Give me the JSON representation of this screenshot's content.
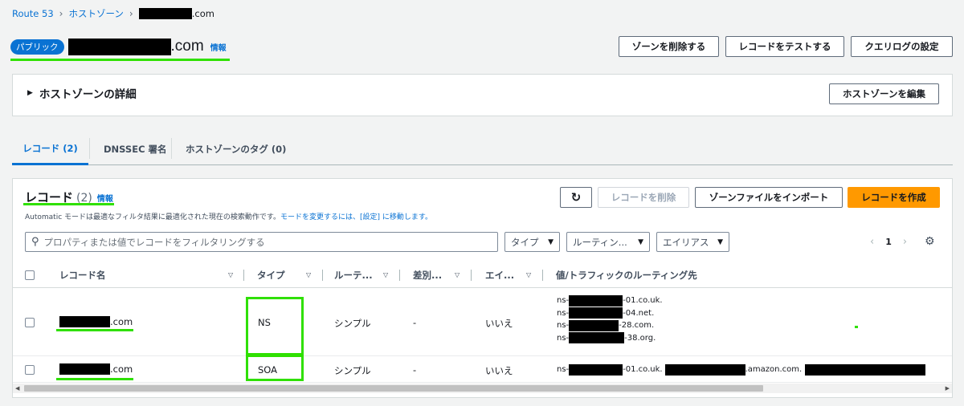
{
  "breadcrumb": {
    "items": [
      "Route 53",
      "ホストゾーン"
    ],
    "current_suffix": ".com"
  },
  "header": {
    "badge": "パブリック",
    "title_suffix": ".com",
    "info": "情報"
  },
  "actions": {
    "delete_zone": "ゾーンを削除する",
    "test_record": "レコードをテストする",
    "query_log": "クエリログの設定"
  },
  "details": {
    "title": "ホストゾーンの詳細",
    "edit_button": "ホストゾーンを編集"
  },
  "tabs": [
    {
      "label": "レコード (2)"
    },
    {
      "label": "DNSSEC 署名"
    },
    {
      "label": "ホストゾーンのタグ (0)"
    }
  ],
  "records": {
    "title": "レコード",
    "count": "(2)",
    "info": "情報",
    "note_prefix": "Automatic モードは最適なフィルタ結果に最適化された現在の検索動作です。",
    "note_link": "モードを変更するには、[設定] に移動します。",
    "refresh_icon": "refresh-icon",
    "delete_button": "レコードを削除",
    "import_button": "ゾーンファイルをインポート",
    "create_button": "レコードを作成",
    "search_placeholder": "プロパティまたは値でレコードをフィルタリングする",
    "filters": {
      "type": "タイプ",
      "routing": "ルーティン...",
      "alias": "エイリアス"
    },
    "page": "1",
    "columns": {
      "name": "レコード名",
      "type": "タイプ",
      "routing": "ルーテ...",
      "diff": "差別...",
      "alias": "エイ...",
      "value": "値/トラフィックのルーティング先"
    },
    "rows": [
      {
        "name_suffix": ".com",
        "type": "NS",
        "routing": "シンプル",
        "diff": "-",
        "alias": "いいえ",
        "values": [
          {
            "prefix": "ns-",
            "suffix": "-01.co.uk."
          },
          {
            "prefix": "ns-",
            "suffix": "-04.net."
          },
          {
            "prefix": "ns-",
            "suffix": "-28.com."
          },
          {
            "prefix": "ns-",
            "suffix": "-38.org."
          }
        ]
      },
      {
        "name_suffix": ".com",
        "type": "SOA",
        "routing": "シンプル",
        "diff": "-",
        "alias": "いいえ",
        "value": {
          "prefix": "ns-",
          "mid": "-01.co.uk.",
          "suffix": ".amazon.com."
        }
      }
    ]
  },
  "colors": {
    "accent": "#0972d3",
    "primary_button": "#ff9900",
    "highlight": "#2fe000"
  }
}
